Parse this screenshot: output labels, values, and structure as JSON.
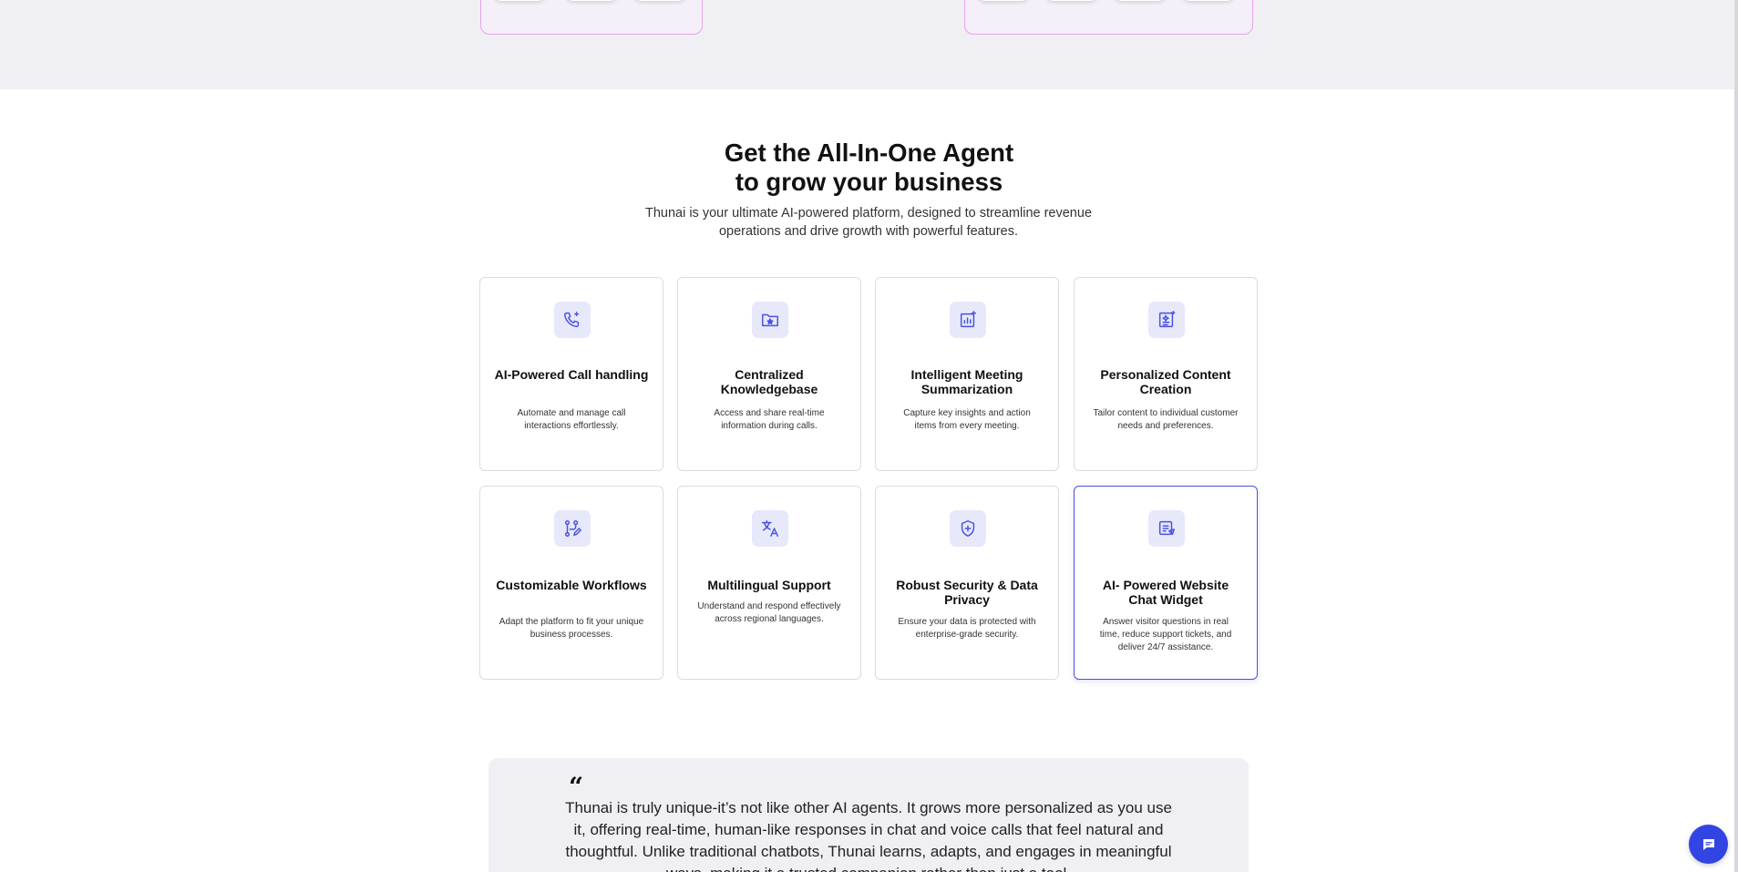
{
  "integrations": {
    "left_icons": [
      "red-ring-app-icon",
      "blue-square-app-icon",
      "whatsapp-icon"
    ],
    "right_icons": [
      "google-colored-app-icon",
      "green-blocks-app-icon",
      "blue-cube-app-icon",
      "dark-circle-app-icon"
    ]
  },
  "section": {
    "title_line1": "Get the All-In-One Agent",
    "title_line2": "to grow your business",
    "subtitle": "Thunai is your ultimate AI-powered platform, designed to streamline revenue operations and drive growth with powerful features."
  },
  "features": [
    {
      "title": "AI-Powered Call handling",
      "desc": "Automate and manage call interactions effortlessly.",
      "icon": "phone-sparkle-icon"
    },
    {
      "title": "Centralized Knowledgebase",
      "desc": "Access and share real-time information during calls.",
      "icon": "folder-star-icon"
    },
    {
      "title": "Intelligent Meeting Summarization",
      "desc": "Capture key insights and action items from every meeting.",
      "icon": "chart-sparkle-icon"
    },
    {
      "title": "Personalized Content Creation",
      "desc": "Tailor content to individual customer needs and preferences.",
      "icon": "content-sparkle-icon"
    },
    {
      "title": "Customizable Workflows",
      "desc": "Adapt the platform to fit your unique business processes.",
      "icon": "workflow-edit-icon"
    },
    {
      "title": "Multilingual Support",
      "desc": "Understand and respond effectively across regional languages.",
      "icon": "translate-icon"
    },
    {
      "title": "Robust Security & Data Privacy",
      "desc": "Ensure your data is protected with enterprise-grade security.",
      "icon": "shield-plus-icon"
    },
    {
      "title": "AI- Powered Website Chat Widget",
      "desc": "Answer visitor questions in real time, reduce support tickets, and deliver 24/7 assistance.",
      "icon": "chat-document-icon"
    }
  ],
  "testimonial": {
    "quote_mark": "“",
    "text": "Thunai is truly unique-it’s not like other AI agents. It grows more personalized as you use it, offering real-time, human-like responses in chat and voice calls that feel natural and thoughtful. Unlike traditional chatbots, Thunai learns, adapts, and engages in meaningful ways, making it a trusted companion rather than just a tool."
  },
  "chat_widget": {
    "icon": "chat-bubble-icon"
  },
  "colors": {
    "accent": "#4a52e0",
    "icon_bg": "#e7e8fa",
    "chat_button": "#3245e3",
    "band_bg": "#f0f0f4",
    "integration_border": "#e8a3ea"
  }
}
